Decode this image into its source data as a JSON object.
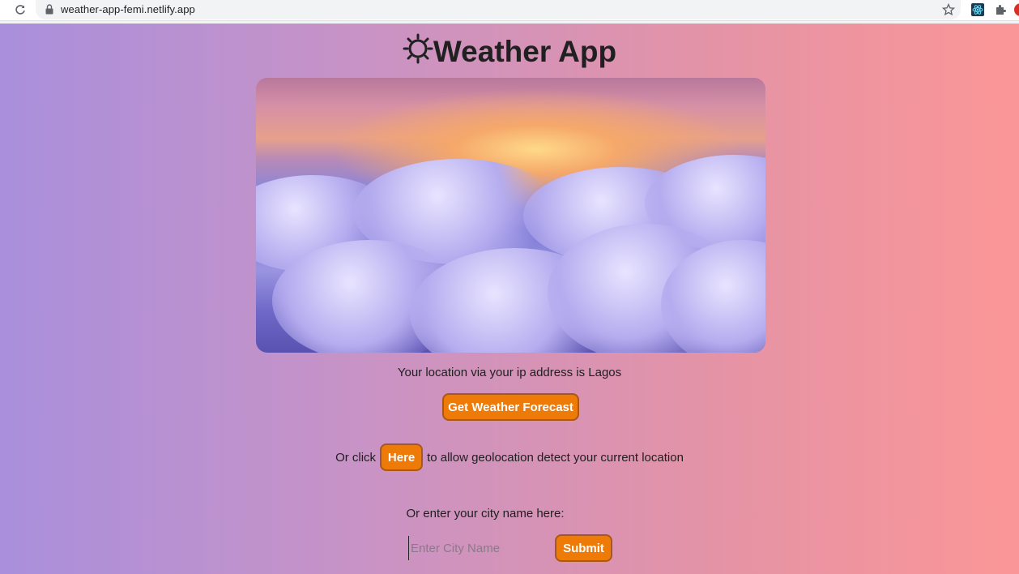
{
  "browser": {
    "url": "weather-app-femi.netlify.app"
  },
  "app": {
    "title": "Weather App",
    "title_icon": "sun-icon",
    "location_message": "Your location via your ip address is Lagos",
    "forecast_button": "Get Weather Forecast",
    "geo_prefix": "Or click",
    "geo_button": "Here",
    "geo_suffix": "to allow geolocation detect your current location",
    "city_label": "Or enter your city name here:",
    "city_placeholder": "Enter City Name",
    "submit_button": "Submit"
  },
  "colors": {
    "button": "#ee7a07",
    "gradient_start": "#a98fdc",
    "gradient_end": "#fb9697"
  }
}
